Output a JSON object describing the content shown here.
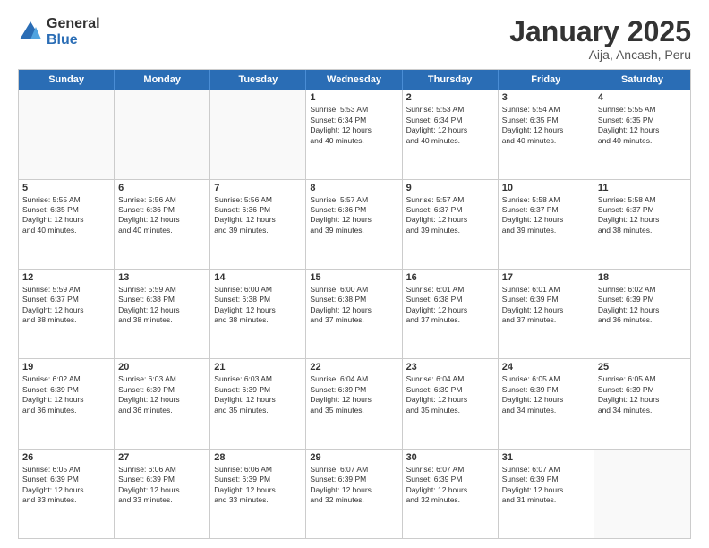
{
  "logo": {
    "general": "General",
    "blue": "Blue"
  },
  "title": "January 2025",
  "subtitle": "Aija, Ancash, Peru",
  "header_days": [
    "Sunday",
    "Monday",
    "Tuesday",
    "Wednesday",
    "Thursday",
    "Friday",
    "Saturday"
  ],
  "weeks": [
    [
      {
        "day": "",
        "info": "",
        "empty": true
      },
      {
        "day": "",
        "info": "",
        "empty": true
      },
      {
        "day": "",
        "info": "",
        "empty": true
      },
      {
        "day": "1",
        "info": "Sunrise: 5:53 AM\nSunset: 6:34 PM\nDaylight: 12 hours\nand 40 minutes."
      },
      {
        "day": "2",
        "info": "Sunrise: 5:53 AM\nSunset: 6:34 PM\nDaylight: 12 hours\nand 40 minutes."
      },
      {
        "day": "3",
        "info": "Sunrise: 5:54 AM\nSunset: 6:35 PM\nDaylight: 12 hours\nand 40 minutes."
      },
      {
        "day": "4",
        "info": "Sunrise: 5:55 AM\nSunset: 6:35 PM\nDaylight: 12 hours\nand 40 minutes."
      }
    ],
    [
      {
        "day": "5",
        "info": "Sunrise: 5:55 AM\nSunset: 6:35 PM\nDaylight: 12 hours\nand 40 minutes."
      },
      {
        "day": "6",
        "info": "Sunrise: 5:56 AM\nSunset: 6:36 PM\nDaylight: 12 hours\nand 40 minutes."
      },
      {
        "day": "7",
        "info": "Sunrise: 5:56 AM\nSunset: 6:36 PM\nDaylight: 12 hours\nand 39 minutes."
      },
      {
        "day": "8",
        "info": "Sunrise: 5:57 AM\nSunset: 6:36 PM\nDaylight: 12 hours\nand 39 minutes."
      },
      {
        "day": "9",
        "info": "Sunrise: 5:57 AM\nSunset: 6:37 PM\nDaylight: 12 hours\nand 39 minutes."
      },
      {
        "day": "10",
        "info": "Sunrise: 5:58 AM\nSunset: 6:37 PM\nDaylight: 12 hours\nand 39 minutes."
      },
      {
        "day": "11",
        "info": "Sunrise: 5:58 AM\nSunset: 6:37 PM\nDaylight: 12 hours\nand 38 minutes."
      }
    ],
    [
      {
        "day": "12",
        "info": "Sunrise: 5:59 AM\nSunset: 6:37 PM\nDaylight: 12 hours\nand 38 minutes."
      },
      {
        "day": "13",
        "info": "Sunrise: 5:59 AM\nSunset: 6:38 PM\nDaylight: 12 hours\nand 38 minutes."
      },
      {
        "day": "14",
        "info": "Sunrise: 6:00 AM\nSunset: 6:38 PM\nDaylight: 12 hours\nand 38 minutes."
      },
      {
        "day": "15",
        "info": "Sunrise: 6:00 AM\nSunset: 6:38 PM\nDaylight: 12 hours\nand 37 minutes."
      },
      {
        "day": "16",
        "info": "Sunrise: 6:01 AM\nSunset: 6:38 PM\nDaylight: 12 hours\nand 37 minutes."
      },
      {
        "day": "17",
        "info": "Sunrise: 6:01 AM\nSunset: 6:39 PM\nDaylight: 12 hours\nand 37 minutes."
      },
      {
        "day": "18",
        "info": "Sunrise: 6:02 AM\nSunset: 6:39 PM\nDaylight: 12 hours\nand 36 minutes."
      }
    ],
    [
      {
        "day": "19",
        "info": "Sunrise: 6:02 AM\nSunset: 6:39 PM\nDaylight: 12 hours\nand 36 minutes."
      },
      {
        "day": "20",
        "info": "Sunrise: 6:03 AM\nSunset: 6:39 PM\nDaylight: 12 hours\nand 36 minutes."
      },
      {
        "day": "21",
        "info": "Sunrise: 6:03 AM\nSunset: 6:39 PM\nDaylight: 12 hours\nand 35 minutes."
      },
      {
        "day": "22",
        "info": "Sunrise: 6:04 AM\nSunset: 6:39 PM\nDaylight: 12 hours\nand 35 minutes."
      },
      {
        "day": "23",
        "info": "Sunrise: 6:04 AM\nSunset: 6:39 PM\nDaylight: 12 hours\nand 35 minutes."
      },
      {
        "day": "24",
        "info": "Sunrise: 6:05 AM\nSunset: 6:39 PM\nDaylight: 12 hours\nand 34 minutes."
      },
      {
        "day": "25",
        "info": "Sunrise: 6:05 AM\nSunset: 6:39 PM\nDaylight: 12 hours\nand 34 minutes."
      }
    ],
    [
      {
        "day": "26",
        "info": "Sunrise: 6:05 AM\nSunset: 6:39 PM\nDaylight: 12 hours\nand 33 minutes."
      },
      {
        "day": "27",
        "info": "Sunrise: 6:06 AM\nSunset: 6:39 PM\nDaylight: 12 hours\nand 33 minutes."
      },
      {
        "day": "28",
        "info": "Sunrise: 6:06 AM\nSunset: 6:39 PM\nDaylight: 12 hours\nand 33 minutes."
      },
      {
        "day": "29",
        "info": "Sunrise: 6:07 AM\nSunset: 6:39 PM\nDaylight: 12 hours\nand 32 minutes."
      },
      {
        "day": "30",
        "info": "Sunrise: 6:07 AM\nSunset: 6:39 PM\nDaylight: 12 hours\nand 32 minutes."
      },
      {
        "day": "31",
        "info": "Sunrise: 6:07 AM\nSunset: 6:39 PM\nDaylight: 12 hours\nand 31 minutes."
      },
      {
        "day": "",
        "info": "",
        "empty": true
      }
    ]
  ]
}
